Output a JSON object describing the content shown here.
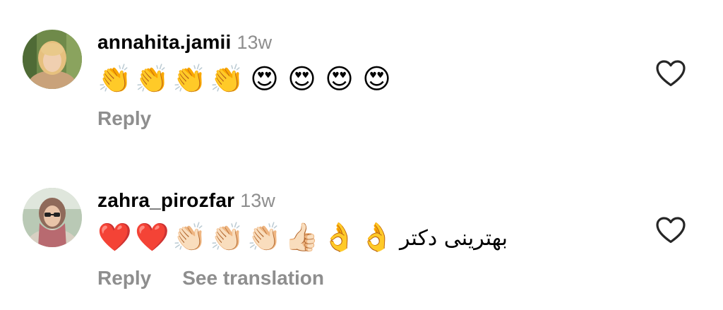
{
  "comments": [
    {
      "username": "annahita.jamii",
      "time": "13w",
      "emojis": [
        "👏",
        "👏",
        "👏",
        "👏",
        "😍",
        "😍",
        "😍",
        "😍"
      ],
      "text": "",
      "reply_label": "Reply",
      "like_icon": "heart-outline-icon"
    },
    {
      "username": "zahra_pirozfar",
      "time": "13w",
      "emojis": [
        "❤️",
        "❤️",
        "👏🏻",
        "👏🏻",
        "👏🏻",
        "👍🏻",
        "👌",
        "👌"
      ],
      "text": "بهترینی دکتر",
      "reply_label": "Reply",
      "translate_label": "See translation",
      "like_icon": "heart-outline-icon"
    }
  ],
  "colors": {
    "secondary_text": "#8e8e8e",
    "primary_text": "#000000",
    "background": "#ffffff"
  }
}
